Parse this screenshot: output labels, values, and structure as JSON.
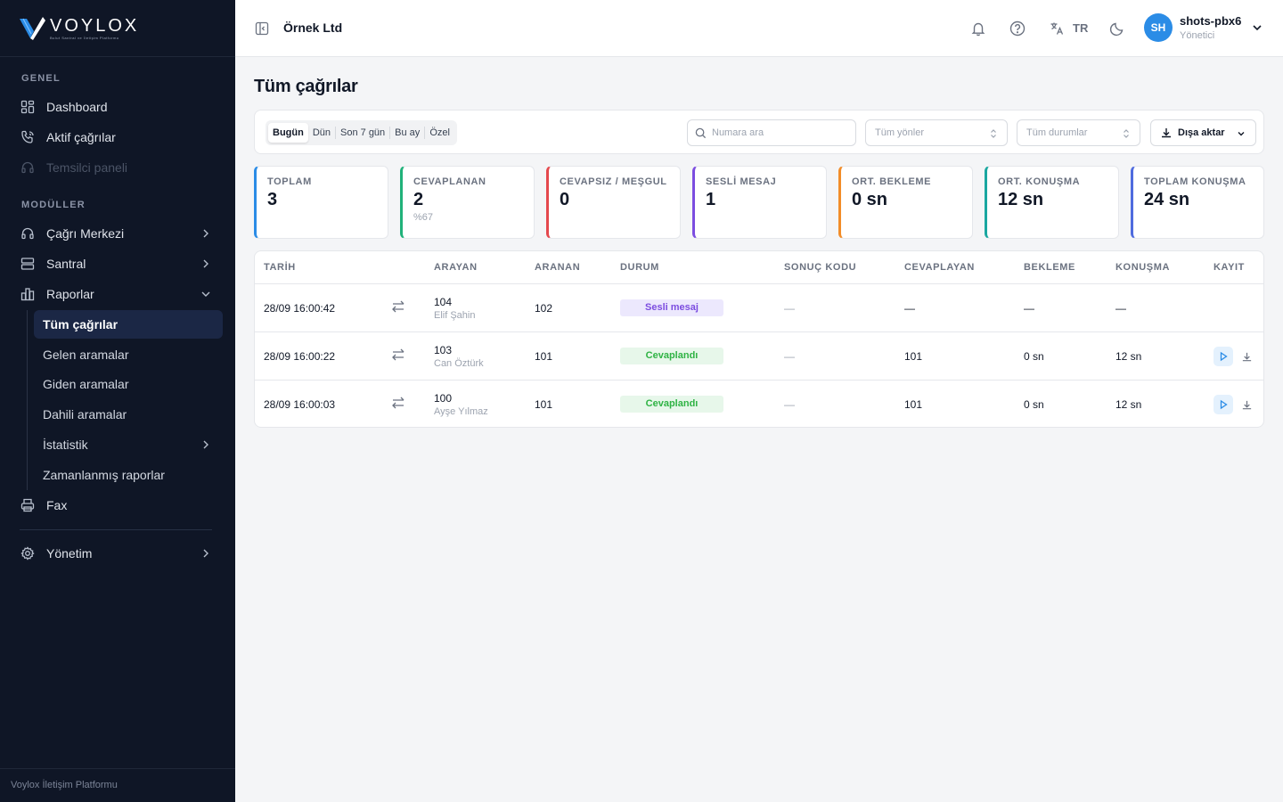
{
  "brand": {
    "name": "VOYLOX",
    "tagline": "Bulut Santral ve İletişim Platformu"
  },
  "sidebar": {
    "section_general": "GENEL",
    "section_modules": "MODÜLLER",
    "general_items": [
      {
        "label": "Dashboard",
        "icon": "dashboard-icon"
      },
      {
        "label": "Aktif çağrılar",
        "icon": "phone-call-icon"
      },
      {
        "label": "Temsilci paneli",
        "icon": "headset-icon",
        "disabled": true
      }
    ],
    "module_items": [
      {
        "label": "Çağrı Merkezi",
        "icon": "headset-icon"
      },
      {
        "label": "Santral",
        "icon": "server-icon"
      },
      {
        "label": "Raporlar",
        "icon": "bar-chart-icon",
        "expanded": true
      }
    ],
    "report_sub_items": [
      {
        "label": "Tüm çağrılar",
        "active": true
      },
      {
        "label": "Gelen aramalar"
      },
      {
        "label": "Giden aramalar"
      },
      {
        "label": "Dahili aramalar"
      },
      {
        "label": "İstatistik"
      },
      {
        "label": "Zamanlanmış raporlar"
      }
    ],
    "fax": "Fax",
    "admin": "Yönetim",
    "footer": "Voylox İletişim Platformu"
  },
  "header": {
    "company": "Örnek Ltd",
    "lang": "TR",
    "user": {
      "initials": "SH",
      "name": "shots-pbx6",
      "role": "Yönetici"
    }
  },
  "page": {
    "title": "Tüm çağrılar"
  },
  "filters": {
    "periods": [
      "Bugün",
      "Dün",
      "Son 7 gün",
      "Bu ay",
      "Özel"
    ],
    "active_period": "Bugün",
    "search_placeholder": "Numara ara",
    "direction_placeholder": "Tüm yönler",
    "status_placeholder": "Tüm durumlar",
    "export_label": "Dışa aktar"
  },
  "stats": [
    {
      "label": "TOPLAM",
      "value": "3",
      "sub": "",
      "color": "#2b8ce6"
    },
    {
      "label": "CEVAPLANAN",
      "value": "2",
      "sub": "%67",
      "color": "#20b27a"
    },
    {
      "label": "CEVAPSIZ / MEŞGUL",
      "value": "0",
      "sub": "",
      "color": "#e5484d"
    },
    {
      "label": "SESLİ MESAJ",
      "value": "1",
      "sub": "",
      "color": "#7c4de0"
    },
    {
      "label": "ORT. BEKLEME",
      "value": "0 sn",
      "sub": "",
      "color": "#f28c28"
    },
    {
      "label": "ORT. KONUŞMA",
      "value": "12 sn",
      "sub": "",
      "color": "#1aa7a0"
    },
    {
      "label": "TOPLAM KONUŞMA",
      "value": "24 sn",
      "sub": "",
      "color": "#4f6bde"
    }
  ],
  "table": {
    "columns": [
      "TARİH",
      "ARAYAN",
      "ARANAN",
      "DURUM",
      "SONUÇ KODU",
      "CEVAPLAYAN",
      "BEKLEME",
      "KONUŞMA",
      "KAYIT"
    ],
    "rows": [
      {
        "date": "28/09 16:00:42",
        "caller": "104",
        "caller_name": "Elif Şahin",
        "callee": "102",
        "status": "Sesli mesaj",
        "status_type": "voicemail",
        "result": "—",
        "answerer": "—",
        "wait": "—",
        "talk": "—",
        "has_recording": false
      },
      {
        "date": "28/09 16:00:22",
        "caller": "103",
        "caller_name": "Can Öztürk",
        "callee": "101",
        "status": "Cevaplandı",
        "status_type": "answered",
        "result": "—",
        "answerer": "101",
        "wait": "0 sn",
        "talk": "12 sn",
        "has_recording": true
      },
      {
        "date": "28/09 16:00:03",
        "caller": "100",
        "caller_name": "Ayşe Yılmaz",
        "callee": "101",
        "status": "Cevaplandı",
        "status_type": "answered",
        "result": "—",
        "answerer": "101",
        "wait": "0 sn",
        "talk": "12 sn",
        "has_recording": true
      }
    ]
  }
}
